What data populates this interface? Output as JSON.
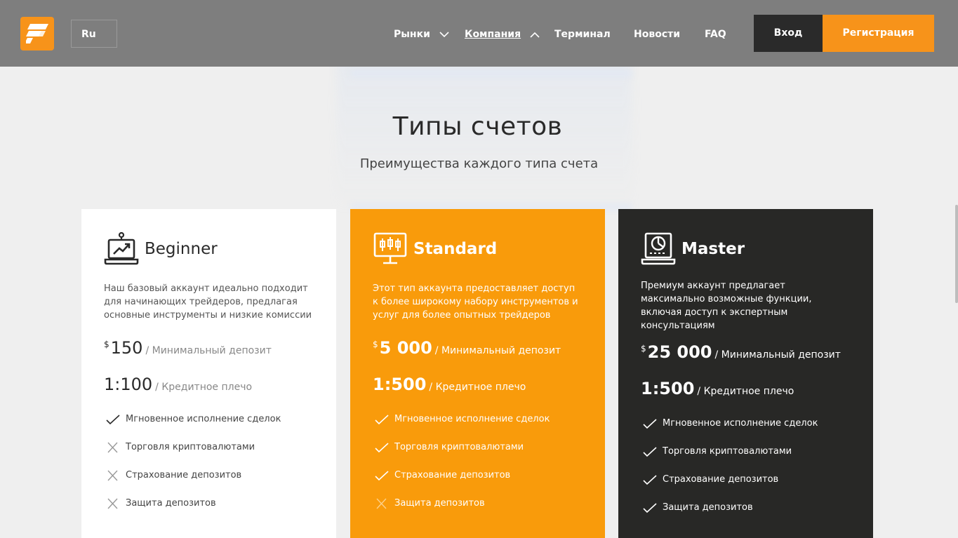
{
  "header": {
    "lang": "Ru",
    "nav": [
      {
        "label": "Рынки",
        "chevron": "down",
        "active": false
      },
      {
        "label": "Компания",
        "chevron": "up",
        "active": true
      },
      {
        "label": "Терминал"
      },
      {
        "label": "Новости"
      },
      {
        "label": "FAQ"
      }
    ],
    "login_label": "Вход",
    "register_label": "Регистрация"
  },
  "section": {
    "title": "Типы счетов",
    "subtitle": "Преимущества каждого типа счета"
  },
  "cards": [
    {
      "name": "Beginner",
      "icon": "laptop-chart-icon",
      "description": "Наш базовый аккаунт идеально подходит для начинающих трейдеров, предлагая основные инструменты и низкие комиссии",
      "currency": "$",
      "deposit": "150",
      "deposit_label": "/ Минимальный депозит",
      "leverage": "1:100",
      "leverage_label": "/ Кредитное плечо",
      "features": [
        {
          "label": "Мгновенное исполнение сделок",
          "included": true
        },
        {
          "label": "Торговля криптовалютами",
          "included": false
        },
        {
          "label": "Страхование депозитов",
          "included": false
        },
        {
          "label": "Защита депозитов",
          "included": false
        }
      ]
    },
    {
      "name": "Standard",
      "icon": "monitor-candles-icon",
      "description": "Этот тип аккаунта предоставляет доступ к более широкому набору инструментов и услуг для более опытных трейдеров",
      "currency": "$",
      "deposit": "5 000",
      "deposit_label": "/ Минимальный депозит",
      "leverage": "1:500",
      "leverage_label": "/ Кредитное плечо",
      "features": [
        {
          "label": "Мгновенное исполнение сделок",
          "included": true
        },
        {
          "label": "Торговля криптовалютами",
          "included": true
        },
        {
          "label": "Страхование депозитов",
          "included": true
        },
        {
          "label": "Защита депозитов",
          "included": false
        }
      ]
    },
    {
      "name": "Master",
      "icon": "laptop-pie-chart-icon",
      "description": "Премиум аккаунт предлагает максимально возможные функции, включая доступ к экспертным консультациям",
      "currency": "$",
      "deposit": "25 000",
      "deposit_label": "/ Минимальный депозит",
      "leverage": "1:500",
      "leverage_label": "/ Кредитное плечо",
      "features": [
        {
          "label": "Мгновенное исполнение сделок",
          "included": true
        },
        {
          "label": "Торговля криптовалютами",
          "included": true
        },
        {
          "label": "Страхование депозитов",
          "included": true
        },
        {
          "label": "Защита депозитов",
          "included": true
        }
      ]
    }
  ],
  "colors": {
    "accent": "#f99b0b",
    "dark": "#282826",
    "header": "#7e7e7e"
  }
}
